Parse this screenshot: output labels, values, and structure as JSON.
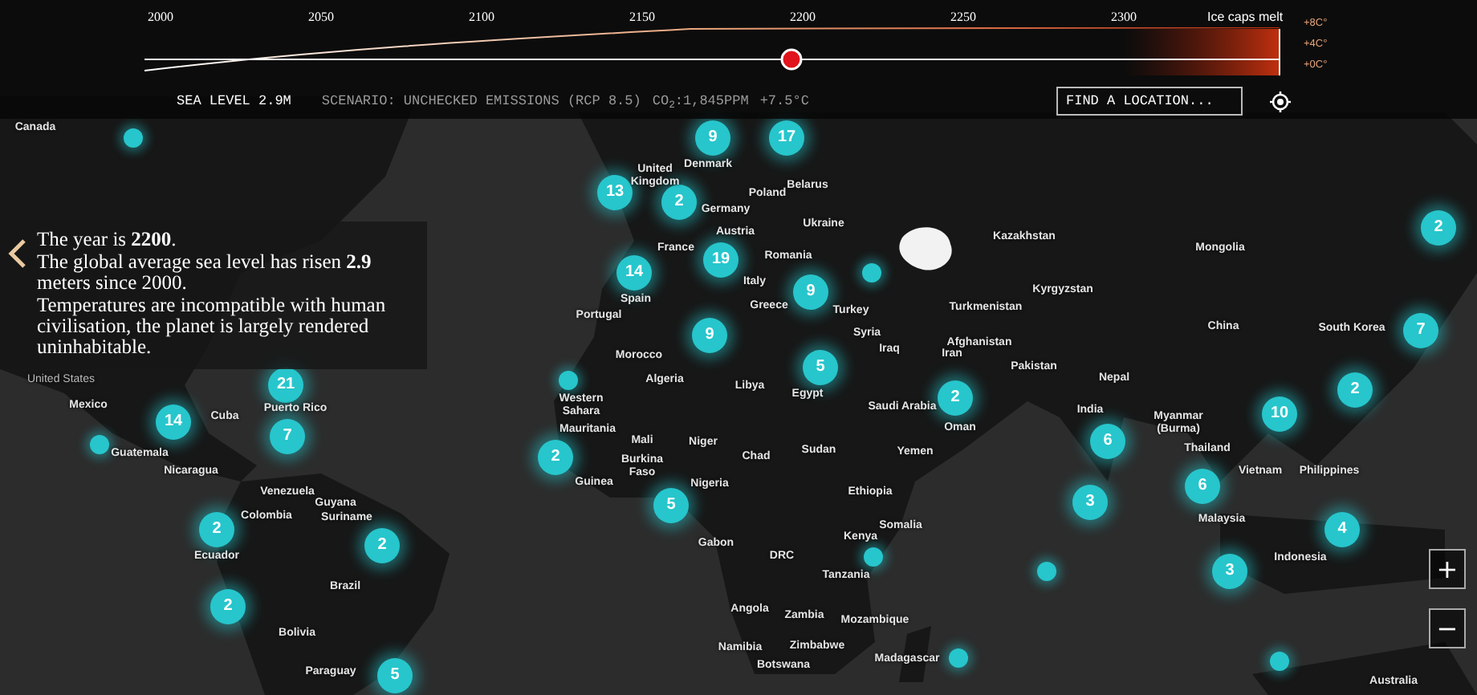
{
  "timeline": {
    "ticks": [
      "2000",
      "2050",
      "2100",
      "2150",
      "2200",
      "2250",
      "2300"
    ],
    "end_label": "Ice caps melt",
    "temperature_labels": [
      "+8C°",
      "+4C°",
      "+0C°"
    ],
    "level": 0.57
  },
  "status": {
    "sea_level": "SEA LEVEL 2.9M",
    "scenario": "SCENARIO: UNCHECKED EMISSIONS (RCP 8.5)",
    "co2": "CO$_{2}$:1,845PPM",
    "temperature": "+7.5°C"
  },
  "search": {
    "placeholder": "FIND A LOCATION..."
  },
  "info_panel": {
    "lines": [
      "The year is **2200**.",
      "The global average sea level has risen  **2.9** meters since 2000.",
      "Temperatures are incompatible with human civilisation, the planet is largely rendered uninhabitable."
    ]
  },
  "map": {
    "labels": [
      {
        "text": "Canada"
      },
      {
        "text": "United Kingdom"
      },
      {
        "text": "Denmark"
      },
      {
        "text": "Germany"
      },
      {
        "text": "Poland"
      },
      {
        "text": "Belarus"
      },
      {
        "text": "Ukraine"
      },
      {
        "text": "Austria"
      },
      {
        "text": "France"
      },
      {
        "text": "Romania"
      },
      {
        "text": "Italy"
      },
      {
        "text": "Spain"
      },
      {
        "text": "Portugal"
      },
      {
        "text": "Greece"
      },
      {
        "text": "Turkey"
      },
      {
        "text": "Syria"
      },
      {
        "text": "Iraq"
      },
      {
        "text": "Iran"
      },
      {
        "text": "Kazakhstan"
      },
      {
        "text": "Kyrgyzstan"
      },
      {
        "text": "Turkmenistan"
      },
      {
        "text": "Afghanistan"
      },
      {
        "text": "Pakistan"
      },
      {
        "text": "Nepal"
      },
      {
        "text": "Mongolia"
      },
      {
        "text": "China"
      },
      {
        "text": "South Korea"
      },
      {
        "text": "Morocco"
      },
      {
        "text": "Algeria"
      },
      {
        "text": "Libya"
      },
      {
        "text": "Egypt"
      },
      {
        "text": "Western Sahara"
      },
      {
        "text": "Saudi Arabia"
      },
      {
        "text": "Oman"
      },
      {
        "text": "India"
      },
      {
        "text": "Myanmar (Burma)"
      },
      {
        "text": "Thailand"
      },
      {
        "text": "Vietnam"
      },
      {
        "text": "Philippines"
      },
      {
        "text": "Malaysia"
      },
      {
        "text": "Indonesia"
      },
      {
        "text": "Mexico"
      },
      {
        "text": "Cuba"
      },
      {
        "text": "Puerto Rico"
      },
      {
        "text": "Guatemala"
      },
      {
        "text": "Nicaragua"
      },
      {
        "text": "Venezuela"
      },
      {
        "text": "Colombia"
      },
      {
        "text": "Guyana"
      },
      {
        "text": "Suriname"
      },
      {
        "text": "Ecuador"
      },
      {
        "text": "Brazil"
      },
      {
        "text": "Bolivia"
      },
      {
        "text": "Paraguay"
      },
      {
        "text": "Mauritania"
      },
      {
        "text": "Mali"
      },
      {
        "text": "Niger"
      },
      {
        "text": "Burkina Faso"
      },
      {
        "text": "Guinea"
      },
      {
        "text": "Nigeria"
      },
      {
        "text": "Chad"
      },
      {
        "text": "Sudan"
      },
      {
        "text": "Yemen"
      },
      {
        "text": "Ethiopia"
      },
      {
        "text": "Somalia"
      },
      {
        "text": "Kenya"
      },
      {
        "text": "Gabon"
      },
      {
        "text": "DRC"
      },
      {
        "text": "Tanzania"
      },
      {
        "text": "Angola"
      },
      {
        "text": "Zambia"
      },
      {
        "text": "Mozambique"
      },
      {
        "text": "Namibia"
      },
      {
        "text": "Zimbabwe"
      },
      {
        "text": "Botswana"
      },
      {
        "text": "Madagascar"
      },
      {
        "text": "Australia"
      },
      {
        "text": "United States"
      }
    ],
    "clusters": [
      {
        "count": "9"
      },
      {
        "count": "17"
      },
      {
        "count": "13"
      },
      {
        "count": "2"
      },
      {
        "count": "19"
      },
      {
        "count": "14"
      },
      {
        "count": "9"
      },
      {
        "count": "9"
      },
      {
        "count": "5"
      },
      {
        "count": "2"
      },
      {
        "count": "2"
      },
      {
        "count": "7"
      },
      {
        "count": "2"
      },
      {
        "count": "10"
      },
      {
        "count": "6"
      },
      {
        "count": "6"
      },
      {
        "count": "3"
      },
      {
        "count": "4"
      },
      {
        "count": "3"
      },
      {
        "count": "21"
      },
      {
        "count": "14"
      },
      {
        "count": "7"
      },
      {
        "count": "2"
      },
      {
        "count": "5"
      },
      {
        "count": "2"
      },
      {
        "count": "2"
      },
      {
        "count": "2"
      },
      {
        "count": "5"
      }
    ]
  },
  "zoom": {
    "buttons": [
      "+",
      "−"
    ]
  }
}
